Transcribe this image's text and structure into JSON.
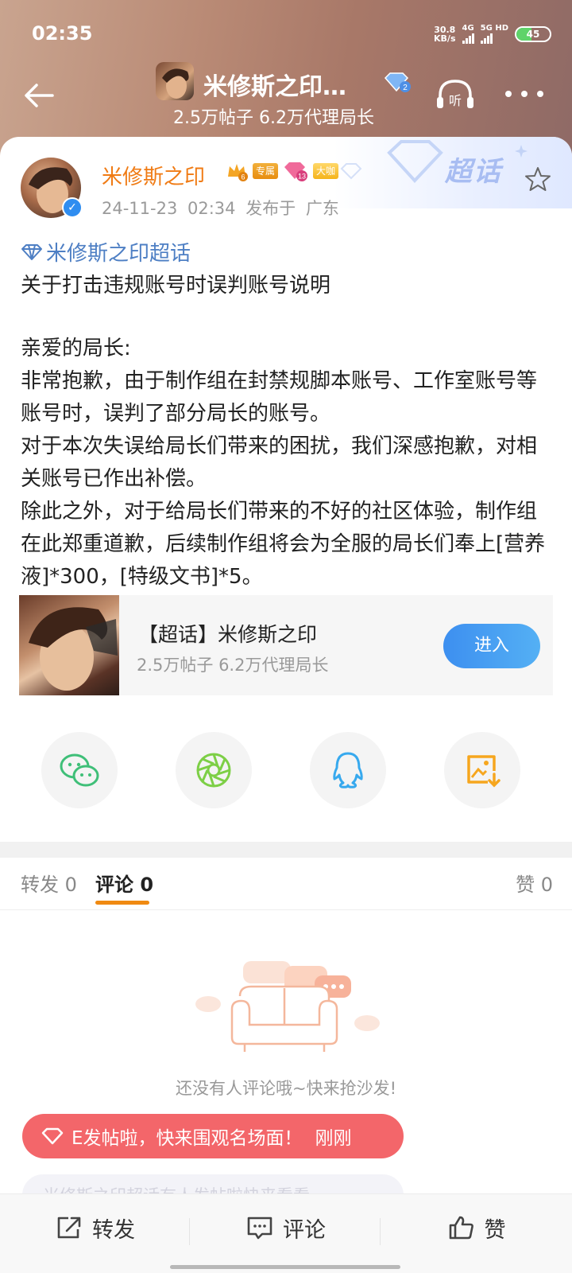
{
  "status": {
    "time": "02:35",
    "speed_value": "30.8",
    "speed_unit": "KB/s",
    "net1": "4G",
    "net2": "5G HD",
    "battery": "45",
    "battery_level": 0.45
  },
  "nav": {
    "title": "米修斯之印…",
    "gem_level": "2",
    "subtitle": "2.5万帖子 6.2万代理局长",
    "listen_label": "听"
  },
  "deco": {
    "text": "超话"
  },
  "post": {
    "author": "米修斯之印",
    "badge_level": "6",
    "badge_exclusive": "专属",
    "badge_gem_level": "13",
    "badge_big": "大咖",
    "time": "24-11-23 02:34",
    "location": "发布于 广东",
    "topic": "米修斯之印超话",
    "title": "关于打击违规账号时误判账号说明",
    "body": [
      "亲爱的局长:",
      "非常抱歉，由于制作组在封禁规脚本账号、工作室账号等账号时，误判了部分局长的账号。",
      "对于本次失误给局长们带来的困扰，我们深感抱歉，对相关账号已作出补偿。",
      "除此之外，对于给局长们带来的不好的社区体验，制作组在此郑重道歉，后续制作组将会为全服的局长们奉上[营养液]*300，[特级文书]*5。"
    ]
  },
  "topic_card": {
    "name": "【超话】米修斯之印",
    "stats": "2.5万帖子 6.2万代理局长",
    "enter_label": "进入"
  },
  "share": {
    "icons": [
      "wechat-icon",
      "moments-icon",
      "qq-icon",
      "save-image-icon"
    ]
  },
  "tabs": {
    "repost": "转发 0",
    "comment": "评论 0",
    "like": "赞 0"
  },
  "empty": {
    "text": "还没有人评论哦~快来抢沙发!"
  },
  "toast": {
    "text": "E发帖啦，快来围观名场面！",
    "time": "刚刚"
  },
  "toast_ghost": {
    "text": "米修斯之印超话有人发帖啦快来看看"
  },
  "bottom": {
    "repost": "转发",
    "comment": "评论",
    "like": "赞"
  },
  "colors": {
    "accent": "#f08a12",
    "link": "#4e7fc4",
    "enter_button": "#3d8ff0",
    "toast": "#f3666a"
  }
}
